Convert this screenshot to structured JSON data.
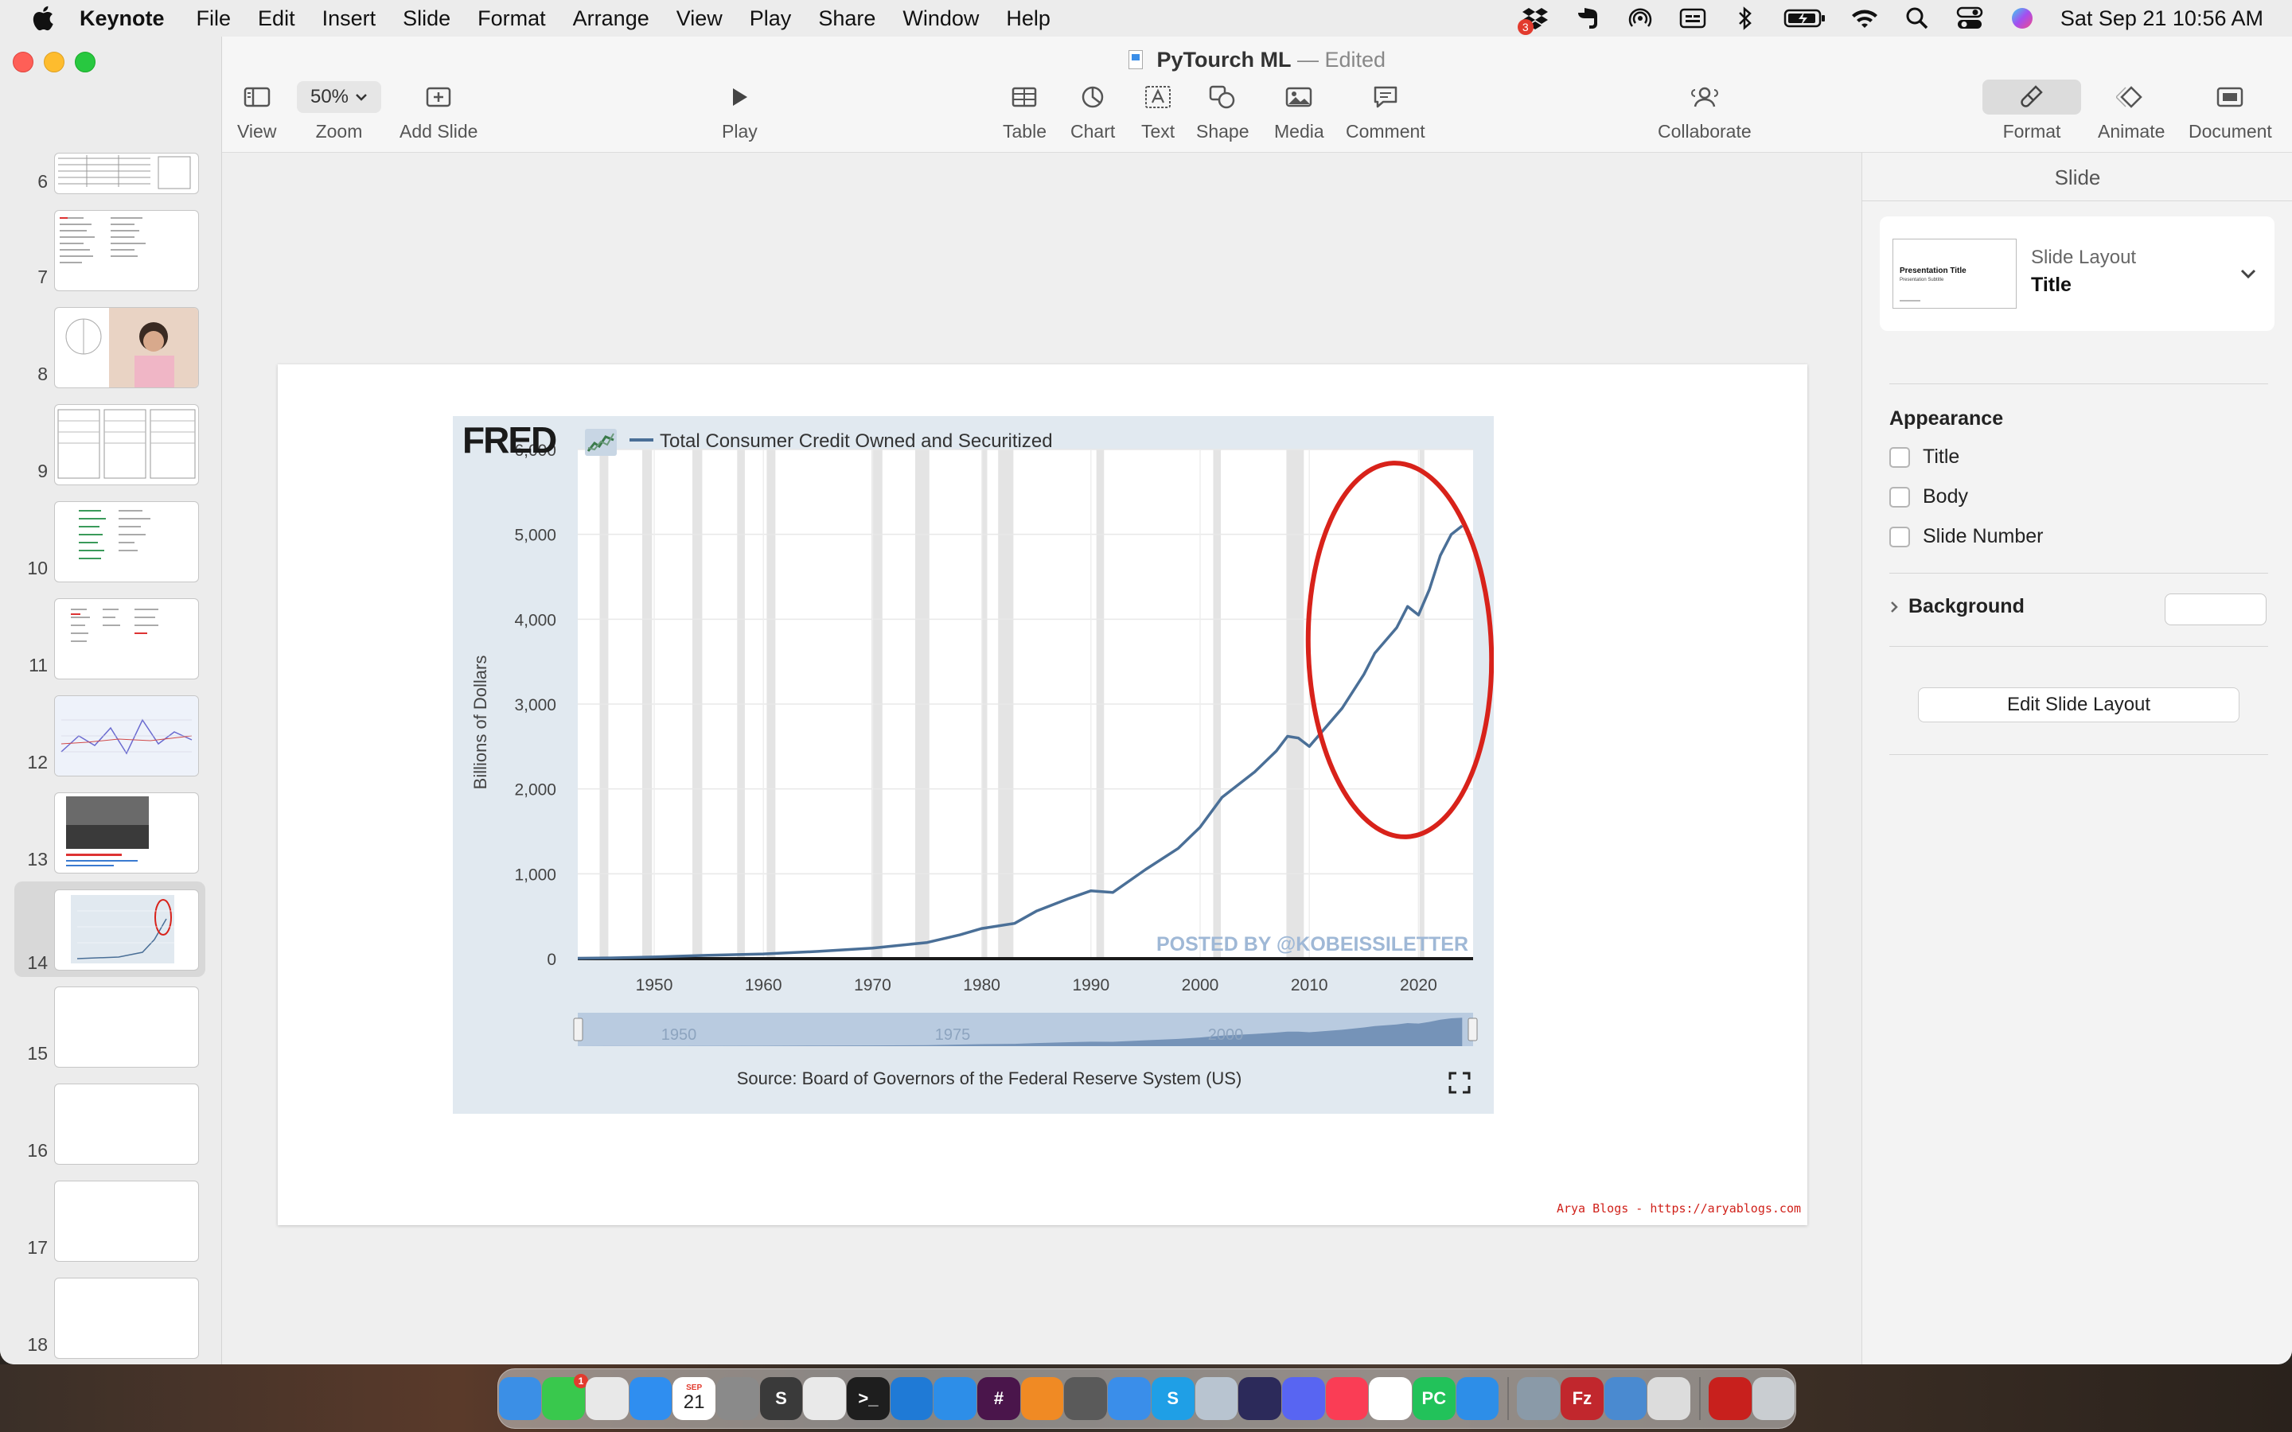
{
  "menubar": {
    "items": [
      "Keynote",
      "File",
      "Edit",
      "Insert",
      "Slide",
      "Format",
      "Arrange",
      "View",
      "Play",
      "Share",
      "Window",
      "Help"
    ],
    "datetime": "Sat Sep 21  10:56 AM",
    "icons": [
      "dropbox-icon",
      "evernote-icon",
      "airdrop-icon",
      "text-input-icon",
      "bluetooth-icon",
      "battery-icon",
      "wifi-icon",
      "spotlight-icon",
      "control-center-icon",
      "siri-icon"
    ],
    "dropbox_badge": "3"
  },
  "window": {
    "doc_title": "PyTourch ML",
    "doc_status": "Edited"
  },
  "toolbar": {
    "view": "View",
    "zoom": "Zoom",
    "zoom_value": "50%",
    "add_slide": "Add Slide",
    "play": "Play",
    "table": "Table",
    "chart": "Chart",
    "text": "Text",
    "shape": "Shape",
    "media": "Media",
    "comment": "Comment",
    "collaborate": "Collaborate",
    "format": "Format",
    "animate": "Animate",
    "document": "Document"
  },
  "navigator": {
    "slides": [
      "6",
      "7",
      "8",
      "9",
      "10",
      "11",
      "12",
      "13",
      "14",
      "15",
      "16",
      "17",
      "18"
    ],
    "selected": "14"
  },
  "slide": {
    "credit": "Arya Blogs - https://aryablogs.com"
  },
  "chart_data": {
    "type": "line",
    "source_logo": "FRED",
    "series": [
      {
        "name": "Total Consumer Credit Owned and Securitized",
        "color": "#4a6f97",
        "points": [
          [
            1943,
            5
          ],
          [
            1946,
            8
          ],
          [
            1950,
            20
          ],
          [
            1955,
            40
          ],
          [
            1960,
            55
          ],
          [
            1965,
            85
          ],
          [
            1970,
            125
          ],
          [
            1975,
            190
          ],
          [
            1978,
            280
          ],
          [
            1980,
            355
          ],
          [
            1983,
            415
          ],
          [
            1985,
            560
          ],
          [
            1988,
            710
          ],
          [
            1990,
            800
          ],
          [
            1992,
            780
          ],
          [
            1995,
            1050
          ],
          [
            1998,
            1300
          ],
          [
            2000,
            1550
          ],
          [
            2002,
            1900
          ],
          [
            2005,
            2200
          ],
          [
            2007,
            2450
          ],
          [
            2008,
            2620
          ],
          [
            2009,
            2600
          ],
          [
            2010,
            2500
          ],
          [
            2011,
            2650
          ],
          [
            2013,
            2950
          ],
          [
            2015,
            3350
          ],
          [
            2016,
            3600
          ],
          [
            2018,
            3900
          ],
          [
            2019,
            4150
          ],
          [
            2020,
            4050
          ],
          [
            2021,
            4350
          ],
          [
            2022,
            4750
          ],
          [
            2023,
            5000
          ],
          [
            2024,
            5100
          ]
        ]
      }
    ],
    "recessions": [
      [
        1945,
        1945.8
      ],
      [
        1948.9,
        1949.8
      ],
      [
        1953.5,
        1954.4
      ],
      [
        1957.6,
        1958.3
      ],
      [
        1960.3,
        1961.1
      ],
      [
        1969.9,
        1970.9
      ],
      [
        1973.9,
        1975.2
      ],
      [
        1980,
        1980.5
      ],
      [
        1981.5,
        1982.9
      ],
      [
        1990.5,
        1991.2
      ],
      [
        2001.2,
        2001.9
      ],
      [
        2007.9,
        2009.5
      ],
      [
        2020.1,
        2020.4
      ]
    ],
    "ylabel": "Billions of Dollars",
    "yticks": [
      "0",
      "1,000",
      "2,000",
      "3,000",
      "4,000",
      "5,000",
      "6,000"
    ],
    "ylim": [
      0,
      6000
    ],
    "xticks": [
      "1950",
      "1960",
      "1970",
      "1980",
      "1990",
      "2000",
      "2010",
      "2020"
    ],
    "xlim": [
      1943,
      2025
    ],
    "watermark": "POSTED BY @KOBEISSILETTER",
    "range_labels": [
      "1950",
      "1975",
      "2000"
    ],
    "source": "Source: Board of Governors of the Federal Reserve System (US)",
    "annotation": "red ellipse highlighting 2009-2024 growth"
  },
  "inspector": {
    "header": "Slide",
    "layout_label": "Slide Layout",
    "layout_value": "Title",
    "thumb_title": "Presentation Title",
    "thumb_subtitle": "Presentation Subtitle",
    "appearance": "Appearance",
    "checkboxes": [
      "Title",
      "Body",
      "Slide Number"
    ],
    "background": "Background",
    "edit_layout": "Edit Slide Layout"
  },
  "dock": {
    "apps": [
      {
        "name": "finder",
        "label": "",
        "color": "#3b8fe6"
      },
      {
        "name": "messages",
        "label": "",
        "color": "#39c84d"
      },
      {
        "name": "launchpad",
        "label": "",
        "color": "#e8e8e8"
      },
      {
        "name": "mail",
        "label": "",
        "color": "#2f8ef0"
      },
      {
        "name": "calendar",
        "label": "21",
        "color": "#ffffff"
      },
      {
        "name": "system-settings",
        "label": "",
        "color": "#8a8a8a"
      },
      {
        "name": "sublime-text",
        "label": "S",
        "color": "#3a3a3a"
      },
      {
        "name": "chrome",
        "label": "",
        "color": "#e9e9e9"
      },
      {
        "name": "terminal",
        "label": ">_",
        "color": "#1e1e1e"
      },
      {
        "name": "vscode",
        "label": "",
        "color": "#1f7ad6"
      },
      {
        "name": "keynote",
        "label": "",
        "color": "#2d8ee8"
      },
      {
        "name": "slack",
        "label": "#",
        "color": "#4a154b"
      },
      {
        "name": "books",
        "label": "",
        "color": "#f08a24"
      },
      {
        "name": "calculator",
        "label": "",
        "color": "#5a5a5a"
      },
      {
        "name": "xcode",
        "label": "",
        "color": "#3a8eea"
      },
      {
        "name": "skype",
        "label": "S",
        "color": "#1f9fe6"
      },
      {
        "name": "preview-settings",
        "label": "",
        "color": "#b8c4d0"
      },
      {
        "name": "eclipse",
        "label": "",
        "color": "#2c2a5a"
      },
      {
        "name": "discord",
        "label": "",
        "color": "#5865f2"
      },
      {
        "name": "music",
        "label": "",
        "color": "#fa3d55"
      },
      {
        "name": "reminders",
        "label": "",
        "color": "#ffffff"
      },
      {
        "name": "pycharm",
        "label": "PC",
        "color": "#22c25a"
      },
      {
        "name": "safari",
        "label": "",
        "color": "#2d8ee8"
      },
      {
        "name": "preview",
        "label": "",
        "color": "#8a9aa8"
      },
      {
        "name": "filezilla",
        "label": "Fz",
        "color": "#c1272d"
      },
      {
        "name": "network-utility",
        "label": "",
        "color": "#4a8ad0"
      },
      {
        "name": "printer",
        "label": "",
        "color": "#dcdcdc"
      },
      {
        "name": "acrobat",
        "label": "",
        "color": "#c8201d"
      },
      {
        "name": "trash",
        "label": "",
        "color": "#c9cdd1"
      }
    ],
    "messages_badge": "1",
    "calendar_month": "SEP"
  }
}
